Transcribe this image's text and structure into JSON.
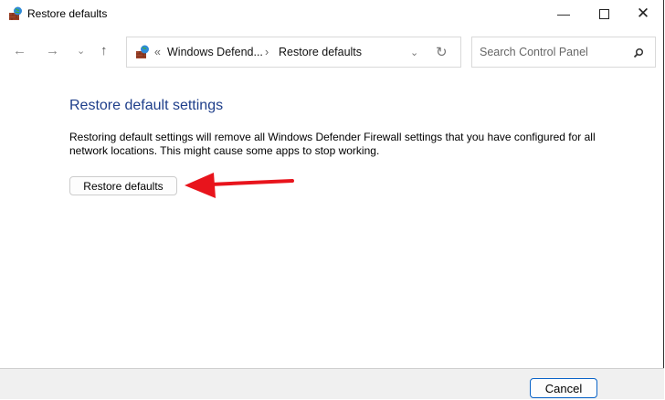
{
  "window": {
    "title": "Restore defaults"
  },
  "nav": {
    "back": "←",
    "forward": "→",
    "recent": "⌄",
    "up": "↑"
  },
  "address": {
    "overflow": "«",
    "crumbs": [
      "Windows Defend...",
      "Restore defaults"
    ],
    "separator": "›",
    "dropdown": "⌄",
    "refresh": "↻"
  },
  "search": {
    "placeholder": "Search Control Panel"
  },
  "main": {
    "heading": "Restore default settings",
    "description": "Restoring default settings will remove all Windows Defender Firewall settings that you have configured for all network locations. This might cause some apps to stop working.",
    "restore_button": "Restore defaults"
  },
  "footer": {
    "cancel_button": "Cancel"
  },
  "colors": {
    "heading": "#1e3e8a",
    "arrow": "#e8141c",
    "cancel_border": "#0a64c8"
  }
}
